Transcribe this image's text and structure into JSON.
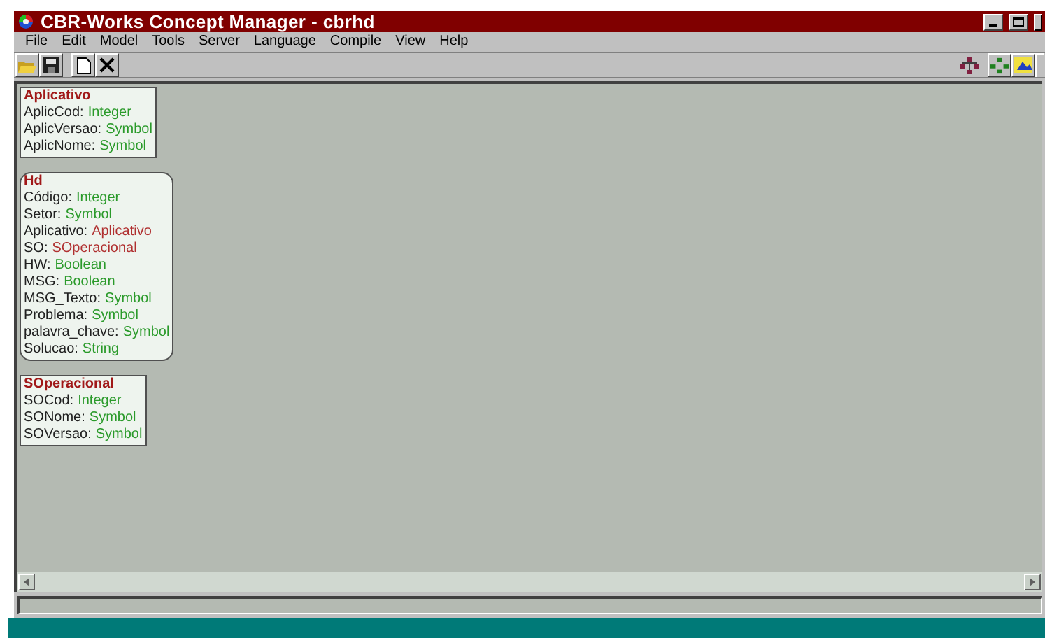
{
  "window": {
    "title": "CBR-Works Concept Manager - cbrhd"
  },
  "menu": [
    "File",
    "Edit",
    "Model",
    "Tools",
    "Server",
    "Language",
    "Compile",
    "View",
    "Help"
  ],
  "concepts": [
    {
      "name": "Aplicativo",
      "kind": "square",
      "attributes": [
        {
          "name": "AplicCod:",
          "type": "Integer",
          "kind": "primitive"
        },
        {
          "name": "AplicVersao:",
          "type": "Symbol",
          "kind": "primitive"
        },
        {
          "name": "AplicNome:",
          "type": "Symbol",
          "kind": "primitive"
        }
      ]
    },
    {
      "name": "Hd",
      "kind": "rounded",
      "attributes": [
        {
          "name": "Código:",
          "type": "Integer",
          "kind": "primitive"
        },
        {
          "name": "Setor:",
          "type": "Symbol",
          "kind": "primitive"
        },
        {
          "name": "Aplicativo:",
          "type": "Aplicativo",
          "kind": "concept"
        },
        {
          "name": "SO:",
          "type": "SOperacional",
          "kind": "concept"
        },
        {
          "name": "HW:",
          "type": "Boolean",
          "kind": "primitive"
        },
        {
          "name": "MSG:",
          "type": "Boolean",
          "kind": "primitive"
        },
        {
          "name": "MSG_Texto:",
          "type": "Symbol",
          "kind": "primitive"
        },
        {
          "name": "Problema:",
          "type": "Symbol",
          "kind": "primitive"
        },
        {
          "name": "palavra_chave:",
          "type": "Symbol",
          "kind": "primitive"
        },
        {
          "name": "Solucao:",
          "type": "String",
          "kind": "primitive"
        }
      ]
    },
    {
      "name": "SOperacional",
      "kind": "square",
      "attributes": [
        {
          "name": "SOCod:",
          "type": "Integer",
          "kind": "primitive"
        },
        {
          "name": "SONome:",
          "type": "Symbol",
          "kind": "primitive"
        },
        {
          "name": "SOVersao:",
          "type": "Symbol",
          "kind": "primitive"
        }
      ]
    }
  ]
}
